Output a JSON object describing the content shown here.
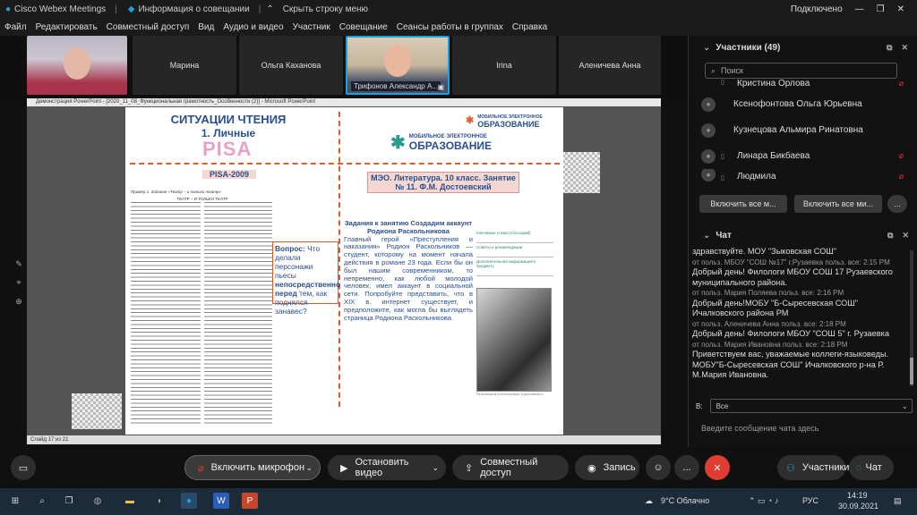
{
  "titlebar": {
    "app": "Cisco Webex Meetings",
    "meeting_info": "Информация о совещании",
    "hide_bar": "Скрыть строку меню",
    "status": "Подключено"
  },
  "menu": [
    "Файл",
    "Редактировать",
    "Совместный доступ",
    "Вид",
    "Аудио и видео",
    "Участник",
    "Совещание",
    "Сеансы работы в группах",
    "Справка"
  ],
  "tiles": [
    {
      "name": "",
      "photo": true
    },
    {
      "name": "Марина",
      "photo": false
    },
    {
      "name": "Ольга Каханова",
      "photo": false
    },
    {
      "name": "Трифонов Александр А...",
      "photo": true
    },
    {
      "name": "Irina",
      "photo": false
    },
    {
      "name": "Аленичева Анна",
      "photo": false
    }
  ],
  "ppt": {
    "window_title": "Демонстрация PowerPoint - [2020_11_08_Функциональная грамотность_Особенности (2)] - Microsoft PowerPoint",
    "status": "Слайд 17 из 21"
  },
  "slide": {
    "title1": "СИТУАЦИИ ЧТЕНИЯ",
    "title2": "1. Личные",
    "pisa": "PISA",
    "pisa_year": "PISA-2009",
    "logo_small_top": "МОБИЛЬНОЕ ЭЛЕКТРОННОЕ",
    "logo_small_bottom": "ОБРАЗОВАНИЕ",
    "logo_big_top": "МОБИЛЬНОЕ ЭЛЕКТРОННОЕ",
    "logo_big_bottom": "ОБРАЗОВАНИЕ",
    "meo_box": "МЭО. Литература. 10 класс. Занятие № 11. Ф.М. Достоевский",
    "example_head": "Пример 1. Задание «Театр – и только театр»",
    "theatre_title": "ТЕАТР – И ТОЛЬКО ТЕАТР",
    "vopros_label": "Вопрос:",
    "vopros_pre": " Что делали персонажи пьесы ",
    "vopros_bold": "непосредственно перед",
    "vopros_post": " тем, как поднялся занавес?",
    "task_head": "Задания к занятию Создадим аккаунт Родиона Раскольникова",
    "task_body": "Главный герой «Преступления и наказания» Родион Раскольников — студент, которому на момент начала действия в романе 23 года. Если бы он был нашим современником, то непременно, как любой молодой человек, имел аккаунт в социальной сети. Попробуйте представить, что в XIX в. интернет существует, и предположите, как могла бы выглядеть страница Родиона Раскольникова.",
    "links": [
      "Ключевые слова (глоссарий)",
      "Советы и рекомендации",
      "Дополнительная информация к предмету"
    ],
    "caption": "Раскольников в иллюстрации Ф.Достоевского"
  },
  "participants": {
    "header": "Участники (49)",
    "search_placeholder": "Поиск",
    "list": [
      {
        "name": "Кристина Орлова",
        "muted": true
      },
      {
        "name": "Ксенофонтова Ольга Юрьевна",
        "muted": false
      },
      {
        "name": "Кузнецова Альмира Ринатовна",
        "muted": false
      },
      {
        "name": "Линара Бикбаева",
        "muted": true
      },
      {
        "name": "Людмила",
        "muted": true
      }
    ],
    "btn_unmute_all": "Включить все м...",
    "btn_mute_all": "Включить все ми...",
    "more": "..."
  },
  "chat": {
    "header": "Чат",
    "lines": [
      {
        "type": "msg",
        "text": "здравствуйте. МОУ \"Зыковская СОШ\""
      },
      {
        "type": "meta",
        "text": "от польз. МБОУ \"СОШ №17\" г.Рузаевка польз. все:",
        "time": "2:15 PM"
      },
      {
        "type": "msg",
        "text": "Добрый день! Филологи МБОУ СОШ 17 Рузаевского муниципального района."
      },
      {
        "type": "meta",
        "text": "от польз. Мария Поляева польз. все:",
        "time": "2:16 PM"
      },
      {
        "type": "msg",
        "text": "Добрый день!МОБУ \"Б-Сыресевская СОШ\" Ичалковского района РМ"
      },
      {
        "type": "meta",
        "text": "от польз. Аленичева Анна польз. все:",
        "time": "2:18 PM"
      },
      {
        "type": "msg",
        "text": "Добрый день! Филологи МБОУ \"СОШ 5\" г. Рузаевка"
      },
      {
        "type": "meta",
        "text": "от польз. Мария Ивановна польз. все:",
        "time": "2:18 PM"
      },
      {
        "type": "msg",
        "text": "Приветствуем вас, уважаемые коллеги-языковеды. МОБУ\"Б-Сыресевская СОШ\" Ичалковского р-на Р. М.Мария Ивановна."
      }
    ],
    "to_label": "В:",
    "to_value": "Все",
    "input_placeholder": "Введите сообщение чата здесь"
  },
  "controls": {
    "mic": "Включить микрофон",
    "video": "Остановить видео",
    "share": "Совместный доступ",
    "record": "Запись",
    "more": "...",
    "participants": "Участники",
    "chat": "Чат"
  },
  "taskbar": {
    "weather": "9°C  Облачно",
    "lang": "РУС",
    "time": "14:19",
    "date": "30.09.2021"
  },
  "colors": {
    "accent": "#1ea0d8",
    "slide_blue": "#2a4f8e",
    "dash": "#e05a2a",
    "end_call": "#e03c31"
  }
}
